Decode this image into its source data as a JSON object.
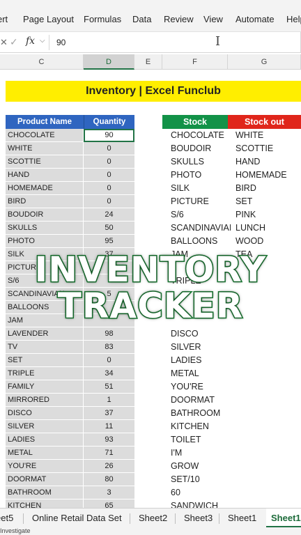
{
  "ribbon": {
    "tabs": [
      "ert",
      "Page Layout",
      "Formulas",
      "Data",
      "Review",
      "View",
      "Automate",
      "Help"
    ]
  },
  "formula_bar": {
    "value": "90",
    "icons": [
      "cancel-icon",
      "enter-icon",
      "fx-icon",
      "chevron-down-icon",
      "text-cursor-icon"
    ]
  },
  "columns": [
    "C",
    "D",
    "E",
    "F",
    "G"
  ],
  "banner": {
    "title": "Inventory  |  Excel Funclub"
  },
  "product_table": {
    "headers": {
      "product": "Product Name",
      "quantity": "Quantity"
    },
    "rows": [
      {
        "name": "CHOCOLATE",
        "qty": "90"
      },
      {
        "name": "WHITE",
        "qty": "0"
      },
      {
        "name": "SCOTTIE",
        "qty": "0"
      },
      {
        "name": "HAND",
        "qty": "0"
      },
      {
        "name": "HOMEMADE",
        "qty": "0"
      },
      {
        "name": "BIRD",
        "qty": "0"
      },
      {
        "name": "BOUDOIR",
        "qty": "24"
      },
      {
        "name": "SKULLS",
        "qty": "50"
      },
      {
        "name": "PHOTO",
        "qty": "95"
      },
      {
        "name": "SILK",
        "qty": "37"
      },
      {
        "name": "PICTURE",
        "qty": ""
      },
      {
        "name": "S/6",
        "qty": ""
      },
      {
        "name": "SCANDINAVIAN",
        "qty": "5"
      },
      {
        "name": "BALLOONS",
        "qty": ""
      },
      {
        "name": "JAM",
        "qty": ""
      },
      {
        "name": "LAVENDER",
        "qty": "98"
      },
      {
        "name": "TV",
        "qty": "83"
      },
      {
        "name": "SET",
        "qty": "0"
      },
      {
        "name": "TRIPLE",
        "qty": "34"
      },
      {
        "name": "FAMILY",
        "qty": "51"
      },
      {
        "name": "MIRRORED",
        "qty": "1"
      },
      {
        "name": "DISCO",
        "qty": "37"
      },
      {
        "name": "SILVER",
        "qty": "11"
      },
      {
        "name": "LADIES",
        "qty": "93"
      },
      {
        "name": "METAL",
        "qty": "71"
      },
      {
        "name": "YOU'RE",
        "qty": "26"
      },
      {
        "name": "DOORMAT",
        "qty": "80"
      },
      {
        "name": "BATHROOM",
        "qty": "3"
      },
      {
        "name": "KITCHEN",
        "qty": "65"
      }
    ]
  },
  "stock": {
    "header": "Stock",
    "items": [
      "CHOCOLATE",
      "BOUDOIR",
      "SKULLS",
      "PHOTO",
      "SILK",
      "PICTURE",
      "S/6",
      "SCANDINAVIAI",
      "BALLOONS",
      "JAM",
      "",
      "TRIPLE",
      "",
      "",
      "",
      "DISCO",
      "SILVER",
      "LADIES",
      "METAL",
      "YOU'RE",
      "DOORMAT",
      "BATHROOM",
      "KITCHEN",
      "TOILET",
      "I'M",
      "GROW",
      "SET/10",
      "60",
      "SANDWICH"
    ]
  },
  "stock_out": {
    "header": "Stock out",
    "items": [
      "WHITE",
      "SCOTTIE",
      "HAND",
      "HOMEMADE",
      "BIRD",
      "SET",
      "PINK",
      "LUNCH",
      "WOOD",
      "TEA"
    ]
  },
  "overlay": {
    "line1": "INVENTORY",
    "line2": "TRACKER"
  },
  "sheet_tabs": {
    "tabs": [
      "eet5",
      "Online Retail Data Set",
      "Sheet2",
      "Sheet3",
      "Sheet1",
      "Sheet1"
    ],
    "active_index": 5
  },
  "status_bar": {
    "text": "Investigate"
  },
  "colors": {
    "banner": "#ffee00",
    "header_blue": "#2f65c0",
    "stock_green": "#129248",
    "stock_out_red": "#e0261b",
    "excel_green": "#217346"
  }
}
